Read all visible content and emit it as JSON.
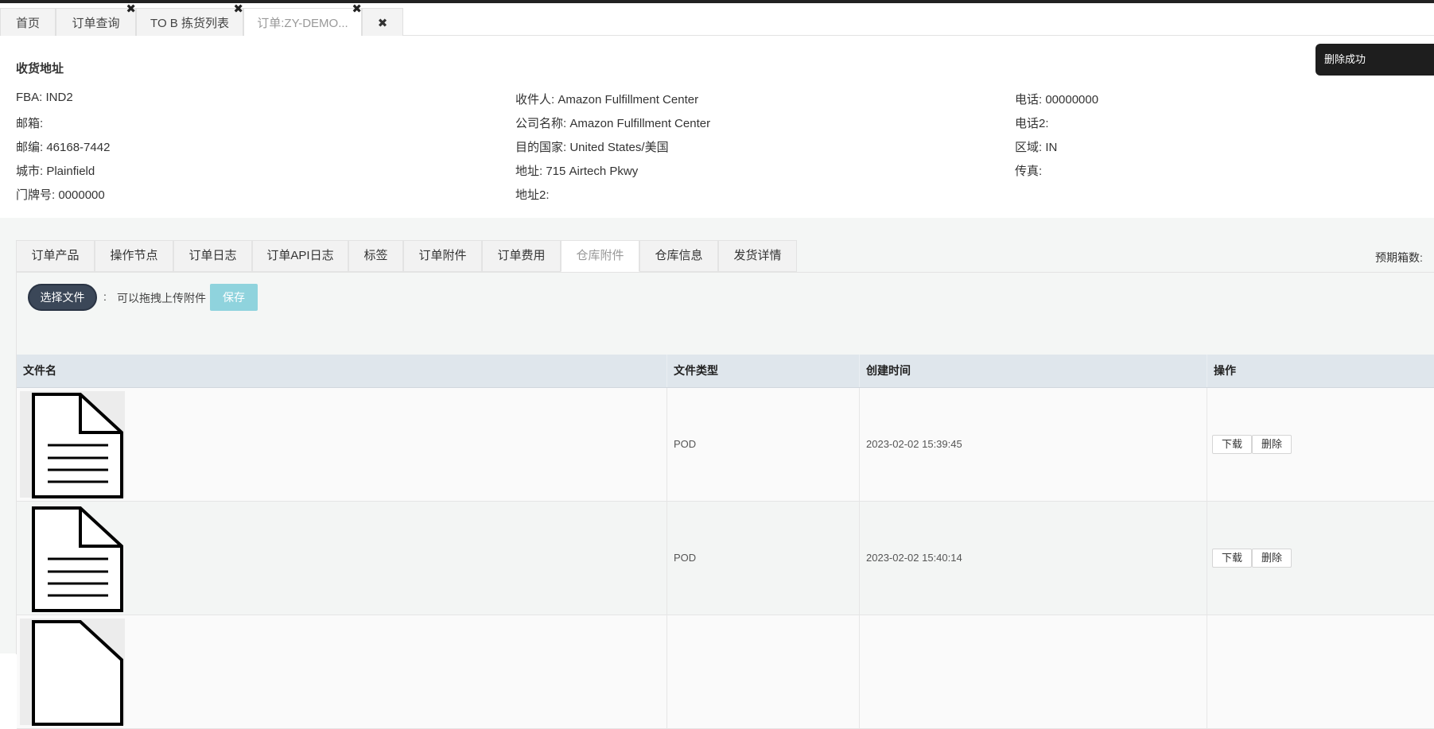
{
  "page_tabs": [
    {
      "label": "首页"
    },
    {
      "label": "订单查询"
    },
    {
      "label": "TO B 拣货列表"
    },
    {
      "label": "订单:ZY-DEMO..."
    }
  ],
  "close_glyph": "✖",
  "toast": {
    "message": "删除成功"
  },
  "address": {
    "title": "收货地址",
    "col1": [
      {
        "label": "FBA:",
        "value": "IND2"
      },
      {
        "label": "邮箱:",
        "value": ""
      },
      {
        "label": "邮编:",
        "value": "46168-7442"
      },
      {
        "label": "城市:",
        "value": "Plainfield"
      },
      {
        "label": "门牌号:",
        "value": "0000000"
      }
    ],
    "col2": [
      {
        "label": "收件人:",
        "value": "Amazon Fulfillment Center"
      },
      {
        "label": "公司名称:",
        "value": "Amazon Fulfillment Center"
      },
      {
        "label": "目的国家:",
        "value": "United States/美国"
      },
      {
        "label": "地址:",
        "value": "715 Airtech Pkwy"
      },
      {
        "label": "地址2:",
        "value": ""
      }
    ],
    "col3": [
      {
        "label": "电话:",
        "value": "00000000"
      },
      {
        "label": "电话2:",
        "value": ""
      },
      {
        "label": "区域:",
        "value": "IN"
      },
      {
        "label": "传真:",
        "value": ""
      }
    ]
  },
  "detail_tabs": [
    {
      "label": "订单产品"
    },
    {
      "label": "操作节点"
    },
    {
      "label": "订单日志"
    },
    {
      "label": "订单API日志"
    },
    {
      "label": "标签"
    },
    {
      "label": "订单附件"
    },
    {
      "label": "订单费用"
    },
    {
      "label": "仓库附件",
      "active": true
    },
    {
      "label": "仓库信息"
    },
    {
      "label": "发货详情"
    }
  ],
  "expected_boxes_label": "预期箱数:",
  "upload": {
    "choose_label": "选择文件",
    "colon": ":",
    "hint": "可以拖拽上传附件",
    "save_label": "保存"
  },
  "table": {
    "headers": [
      "文件名",
      "文件类型",
      "创建时间",
      "操作"
    ],
    "rows": [
      {
        "file_type": "POD",
        "created": "2023-02-02 15:39:45",
        "download": "下载",
        "delete": "删除"
      },
      {
        "file_type": "POD",
        "created": "2023-02-02 15:40:14",
        "download": "下载",
        "delete": "删除"
      }
    ]
  },
  "icons": {
    "file_thumbnail": "document-icon",
    "tab_close": "close-icon"
  }
}
